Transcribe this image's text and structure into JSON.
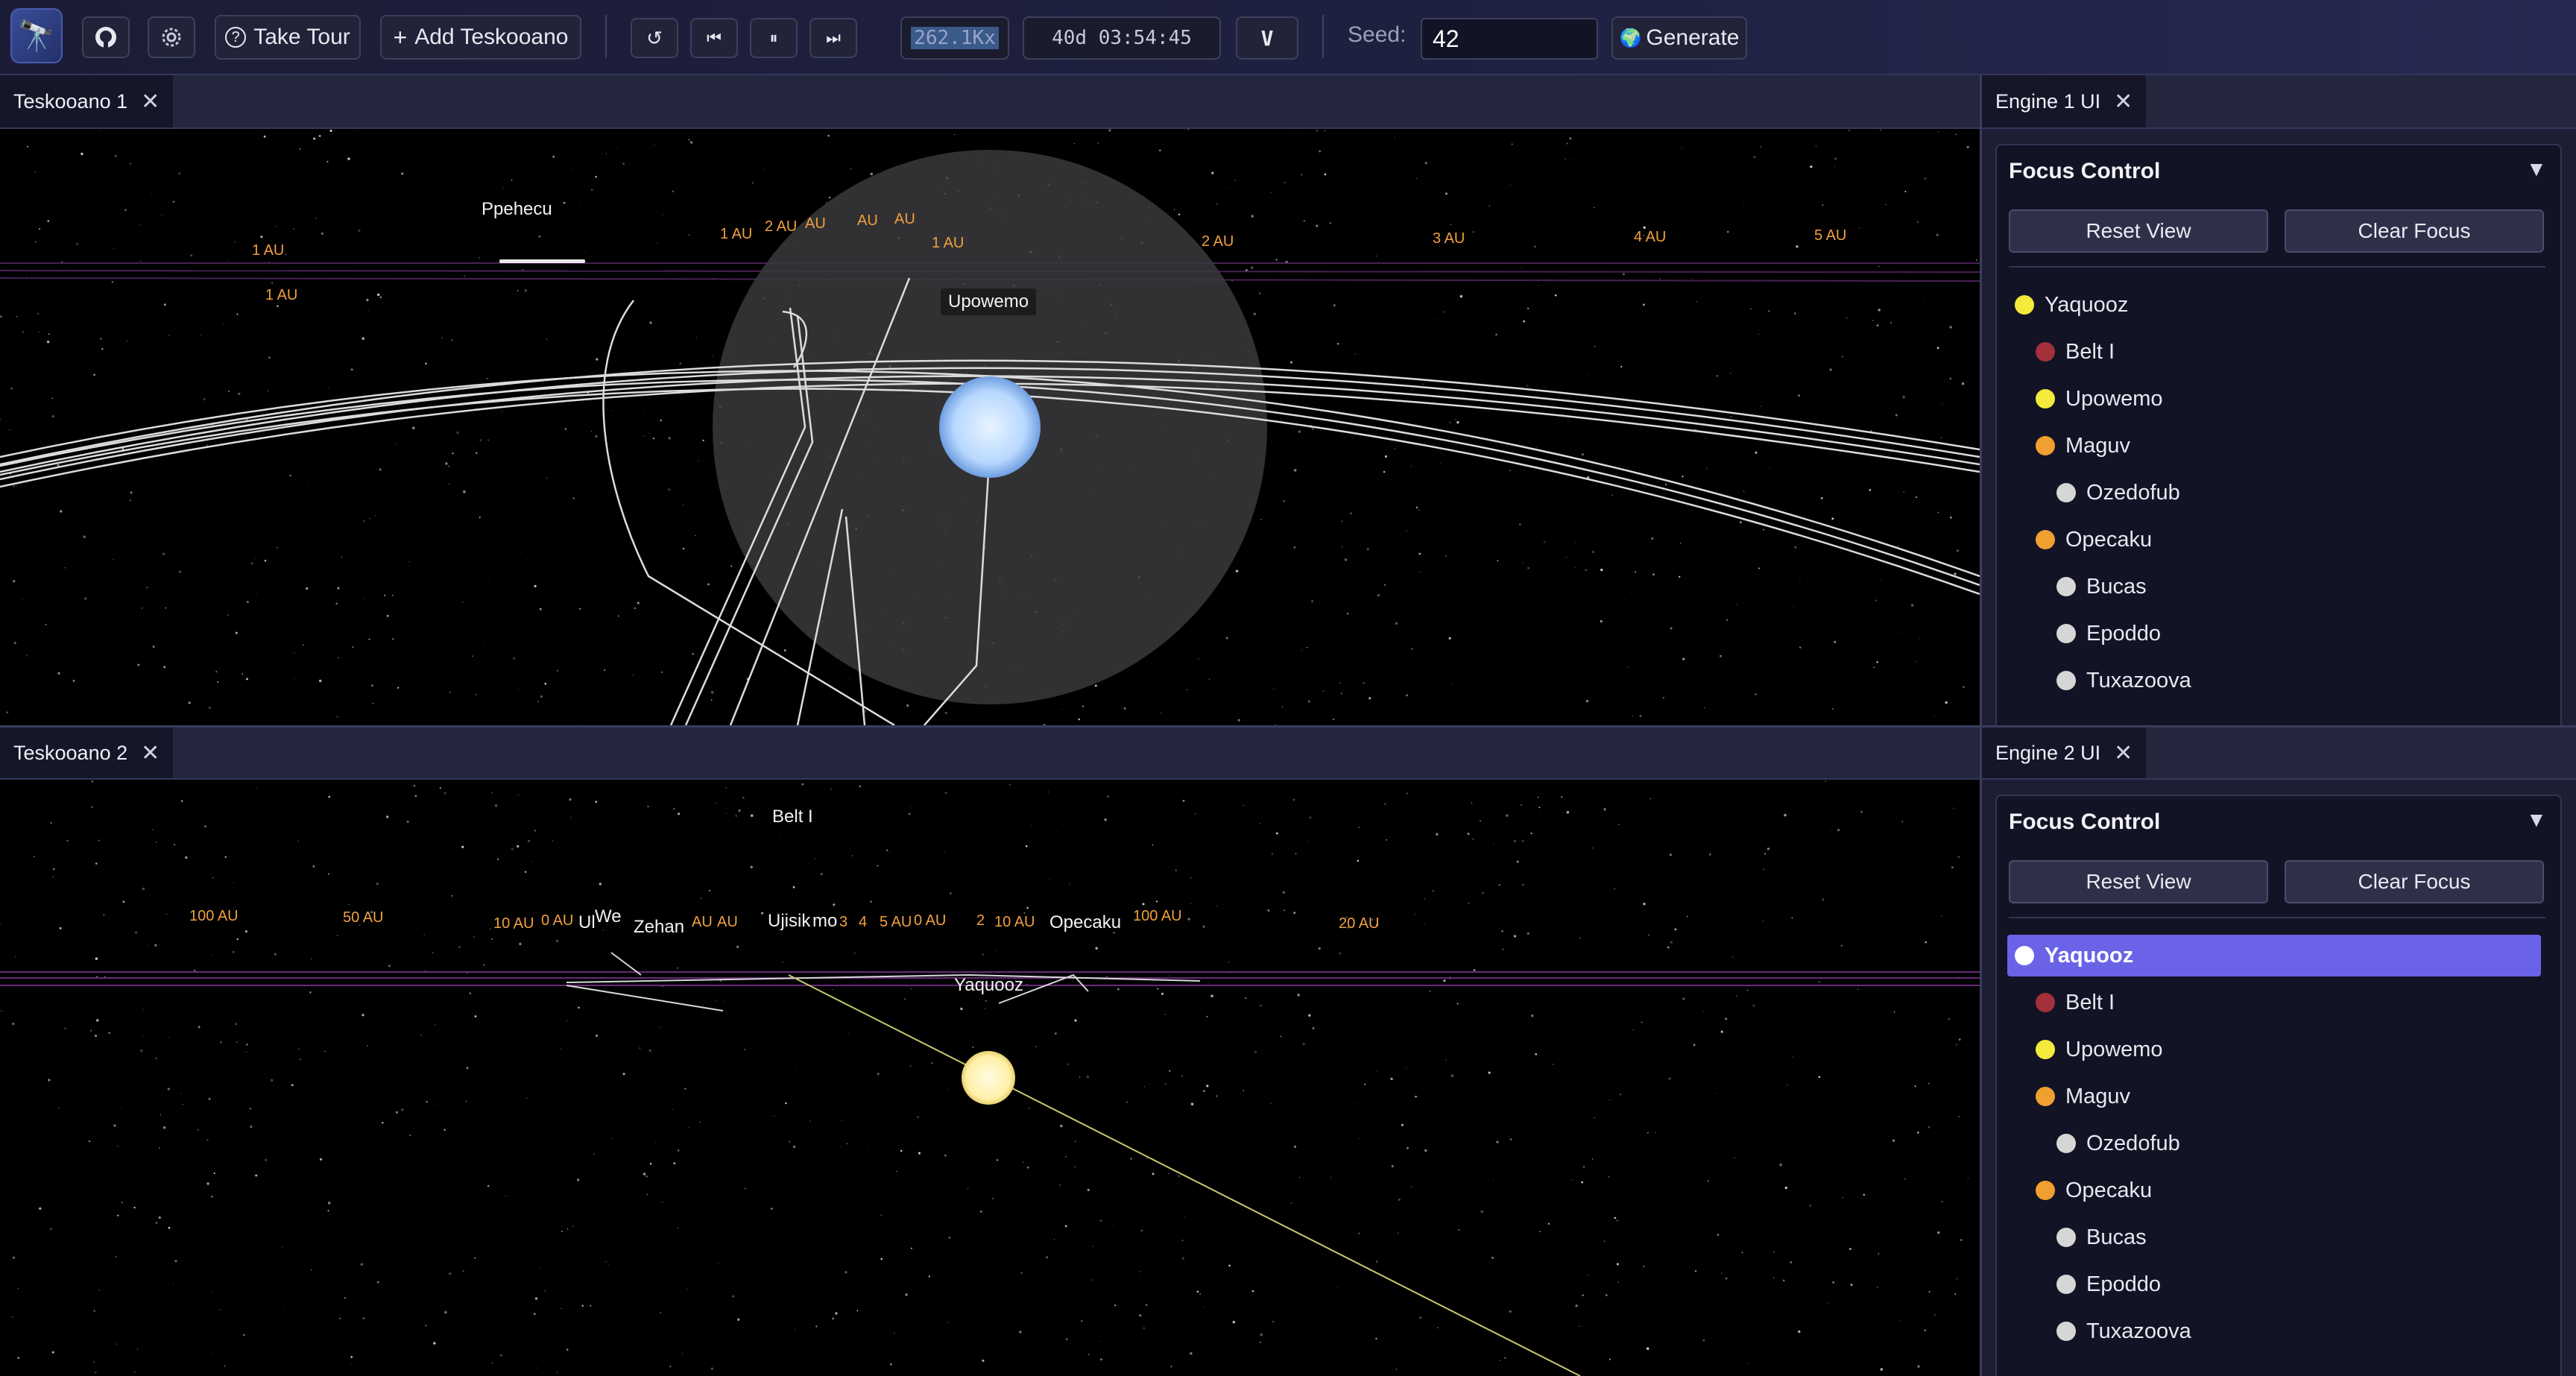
{
  "toolbar": {
    "github_icon": "github-icon",
    "settings_icon": "gear-icon",
    "take_tour": "Take Tour",
    "add_teskooano": "Add Teskooano",
    "speed": "262.1Kx",
    "sim_time": "40d 03:54:45",
    "version_label": "V",
    "seed_label": "Seed:",
    "seed_value": "42",
    "generate": "Generate"
  },
  "panel1": {
    "tab": "Teskooano 1",
    "labels": {
      "ppehecu": "Ppehecu",
      "upowemo": "Upowemo",
      "au_a": "1 AU",
      "au_b": "1 AU",
      "au_c": "1 AU",
      "au_d": "2 AU",
      "au_e": "AU",
      "au_f": "AU",
      "au_g": "AU",
      "au_h": "1 AU",
      "au_i": "2 AU",
      "au_j": "3 AU",
      "au_k": "4 AU",
      "au_l": "5 AU"
    }
  },
  "panel2": {
    "tab": "Teskooano 2",
    "labels": {
      "belt": "Belt I",
      "zehan": "Zehan",
      "ujisik": "Ujisik",
      "mo": "mo",
      "opecaku": "Opecaku",
      "yaquooz": "Yaquooz",
      "we": "We",
      "ul": "Ul",
      "au_100a": "100 AU",
      "au_50": "50 AU",
      "au_10a": "10 AU",
      "au_0": "0 AU",
      "au_mid1": "AU",
      "au_mid2": "AU",
      "au_3": "3",
      "au_4": "4",
      "au_5": "5 AU",
      "au_0b": "0 AU",
      "au_2": "2",
      "au_10b": "10 AU",
      "au_100b": "100 AU",
      "au_20": "20 AU"
    }
  },
  "engine1": {
    "tab": "Engine 1 UI",
    "title": "Focus Control",
    "reset": "Reset View",
    "clear": "Clear Focus",
    "items": [
      {
        "label": "Yaquooz",
        "color": "#f3ea3b",
        "level": 0,
        "selected": false
      },
      {
        "label": "Belt I",
        "color": "#a3303a",
        "level": 1,
        "selected": false
      },
      {
        "label": "Upowemo",
        "color": "#f3ea3b",
        "level": 1,
        "selected": false
      },
      {
        "label": "Maguv",
        "color": "#f0a030",
        "level": 2,
        "selected": false
      },
      {
        "label": "Ozedofub",
        "color": "#d6d6d6",
        "level": 3,
        "selected": false
      },
      {
        "label": "Opecaku",
        "color": "#f0a030",
        "level": 2,
        "selected": false
      },
      {
        "label": "Bucas",
        "color": "#d6d6d6",
        "level": 3,
        "selected": false
      },
      {
        "label": "Epoddo",
        "color": "#d6d6d6",
        "level": 3,
        "selected": false
      },
      {
        "label": "Tuxazoova",
        "color": "#d6d6d6",
        "level": 3,
        "selected": false
      }
    ]
  },
  "engine2": {
    "tab": "Engine 2 UI",
    "title": "Focus Control",
    "reset": "Reset View",
    "clear": "Clear Focus",
    "items": [
      {
        "label": "Yaquooz",
        "color": "#ffffff",
        "level": 0,
        "selected": true
      },
      {
        "label": "Belt I",
        "color": "#a3303a",
        "level": 1,
        "selected": false
      },
      {
        "label": "Upowemo",
        "color": "#f3ea3b",
        "level": 1,
        "selected": false
      },
      {
        "label": "Maguv",
        "color": "#f0a030",
        "level": 2,
        "selected": false
      },
      {
        "label": "Ozedofub",
        "color": "#d6d6d6",
        "level": 3,
        "selected": false
      },
      {
        "label": "Opecaku",
        "color": "#f0a030",
        "level": 2,
        "selected": false
      },
      {
        "label": "Bucas",
        "color": "#d6d6d6",
        "level": 3,
        "selected": false
      },
      {
        "label": "Epoddo",
        "color": "#d6d6d6",
        "level": 3,
        "selected": false
      },
      {
        "label": "Tuxazoova",
        "color": "#d6d6d6",
        "level": 3,
        "selected": false
      }
    ]
  }
}
